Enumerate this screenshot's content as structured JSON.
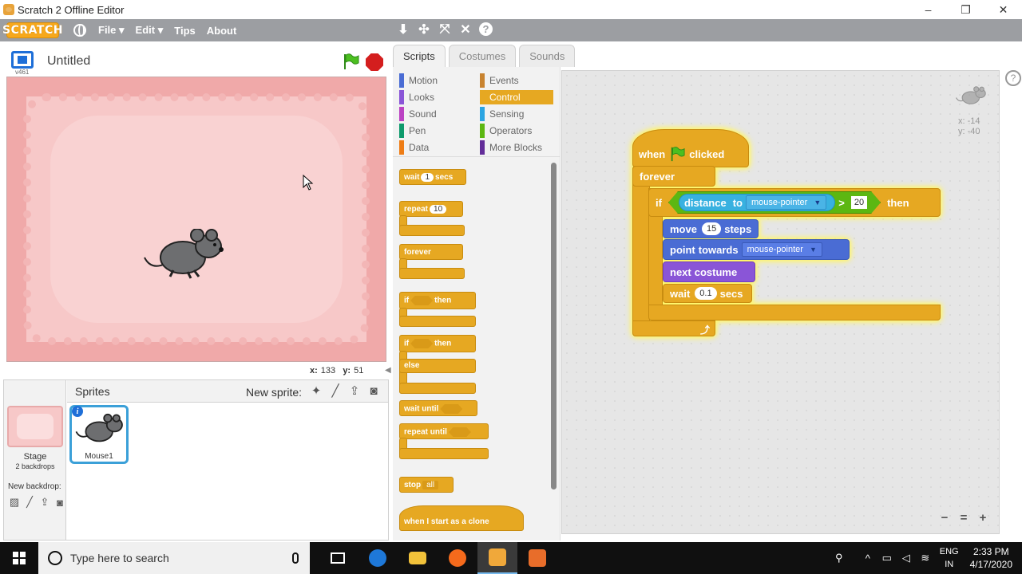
{
  "window": {
    "title": "Scratch 2 Offline Editor",
    "minimize": "–",
    "maximize": "❐",
    "close": "✕"
  },
  "menubar": {
    "logo": "SCRATCH",
    "items": [
      "File ▾",
      "Edit ▾",
      "Tips",
      "About"
    ],
    "tool_icons": [
      "stamp-icon",
      "cut-icon",
      "grow-icon",
      "shrink-icon",
      "help-icon"
    ],
    "help_glyph": "?"
  },
  "stage": {
    "version": "v461",
    "project_title": "Untitled",
    "coords": {
      "x_label": "x:",
      "x": "133",
      "y_label": "y:",
      "y": "51"
    }
  },
  "sprites_pane": {
    "title": "Sprites",
    "new_sprite_label": "New sprite:",
    "stage_name": "Stage",
    "backdrops_count": "2 backdrops",
    "new_backdrop_label": "New backdrop:",
    "sprite": {
      "name": "Mouse1",
      "info": "i"
    }
  },
  "tabs": [
    {
      "label": "Scripts",
      "active": true
    },
    {
      "label": "Costumes",
      "active": false
    },
    {
      "label": "Sounds",
      "active": false
    }
  ],
  "categories": [
    {
      "label": "Motion",
      "color": "#4a6cd4"
    },
    {
      "label": "Looks",
      "color": "#8a55d7"
    },
    {
      "label": "Sound",
      "color": "#bb42c3"
    },
    {
      "label": "Pen",
      "color": "#0e9a6c"
    },
    {
      "label": "Data",
      "color": "#ee7d16"
    },
    {
      "label": "Events",
      "color": "#c88330"
    },
    {
      "label": "Control",
      "color": "#e6a822",
      "selected": true
    },
    {
      "label": "Sensing",
      "color": "#2ca5e2"
    },
    {
      "label": "Operators",
      "color": "#5cb712"
    },
    {
      "label": "More Blocks",
      "color": "#632d99"
    }
  ],
  "palette": {
    "wait": {
      "pre": "wait",
      "val": "1",
      "post": "secs"
    },
    "repeat": {
      "pre": "repeat",
      "val": "10"
    },
    "forever": "forever",
    "if_then": {
      "pre": "if",
      "post": "then"
    },
    "if_else": {
      "pre": "if",
      "post": "then",
      "else": "else"
    },
    "wait_until": "wait until",
    "repeat_until": "repeat until",
    "stop": {
      "pre": "stop",
      "val": "all"
    },
    "clone_hat": "when I start as a clone"
  },
  "script": {
    "hat": {
      "pre": "when",
      "post": "clicked"
    },
    "forever": "forever",
    "if": "if",
    "distance": "distance",
    "to": "to",
    "target": "mouse-pointer",
    "op": ">",
    "threshold": "20",
    "then": "then",
    "move": {
      "pre": "move",
      "val": "15",
      "post": "steps"
    },
    "point": {
      "pre": "point",
      "mid": "towards",
      "target": "mouse-pointer"
    },
    "next_costume": {
      "pre": "next",
      "post": "costume"
    },
    "wait": {
      "pre": "wait",
      "val": "0.1",
      "post": "secs"
    }
  },
  "script_area": {
    "help": "?",
    "x_readout": "x: -14",
    "y_readout": "y: -40",
    "zoom_out": "−",
    "zoom_reset": "=",
    "zoom_in": "+"
  },
  "taskbar": {
    "search_placeholder": "Type here to search",
    "lang_top": "ENG",
    "lang_bottom": "IN",
    "time": "2:33 PM",
    "date": "4/17/2020"
  }
}
